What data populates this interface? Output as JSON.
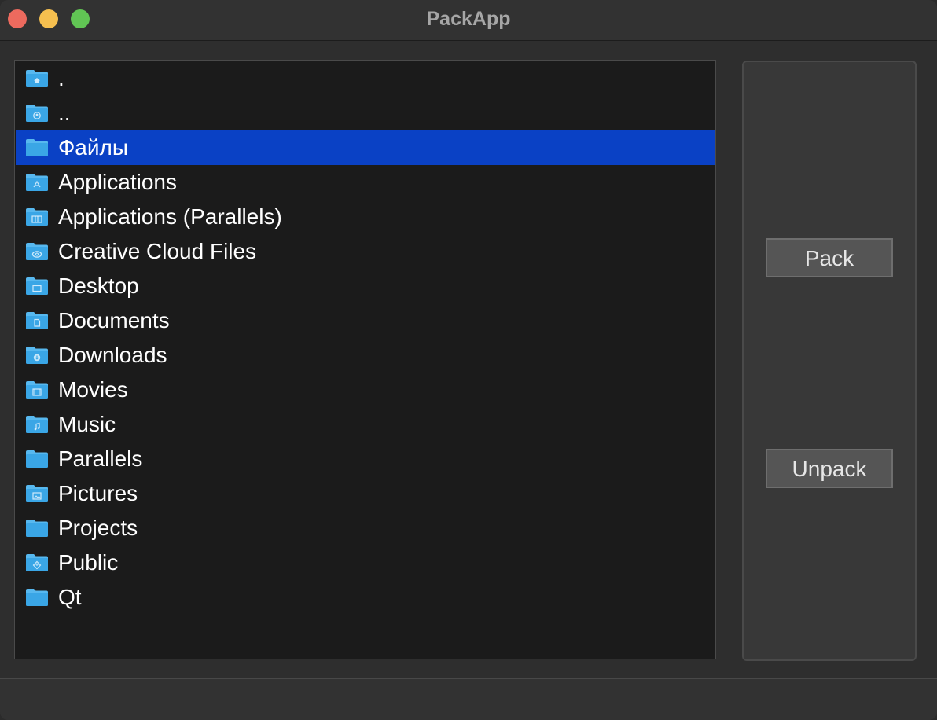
{
  "window": {
    "title": "PackApp"
  },
  "file_list": {
    "selected_index": 2,
    "items": [
      {
        "label": ".",
        "icon": "home-folder-icon"
      },
      {
        "label": "..",
        "icon": "user-folder-icon"
      },
      {
        "label": "Файлы",
        "icon": "folder-icon"
      },
      {
        "label": "Applications",
        "icon": "applications-folder-icon"
      },
      {
        "label": "Applications (Parallels)",
        "icon": "parallels-apps-folder-icon"
      },
      {
        "label": "Creative Cloud Files",
        "icon": "creative-cloud-folder-icon"
      },
      {
        "label": "Desktop",
        "icon": "desktop-folder-icon"
      },
      {
        "label": "Documents",
        "icon": "documents-folder-icon"
      },
      {
        "label": "Downloads",
        "icon": "downloads-folder-icon"
      },
      {
        "label": "Movies",
        "icon": "movies-folder-icon"
      },
      {
        "label": "Music",
        "icon": "music-folder-icon"
      },
      {
        "label": "Parallels",
        "icon": "folder-icon"
      },
      {
        "label": "Pictures",
        "icon": "pictures-folder-icon"
      },
      {
        "label": "Projects",
        "icon": "folder-icon"
      },
      {
        "label": "Public",
        "icon": "public-folder-icon"
      },
      {
        "label": "Qt",
        "icon": "folder-icon"
      }
    ]
  },
  "actions": {
    "pack_label": "Pack",
    "unpack_label": "Unpack"
  },
  "colors": {
    "selection": "#0a41c5",
    "folder_body": "#3aa6e6",
    "folder_tab": "#57b8ef"
  }
}
